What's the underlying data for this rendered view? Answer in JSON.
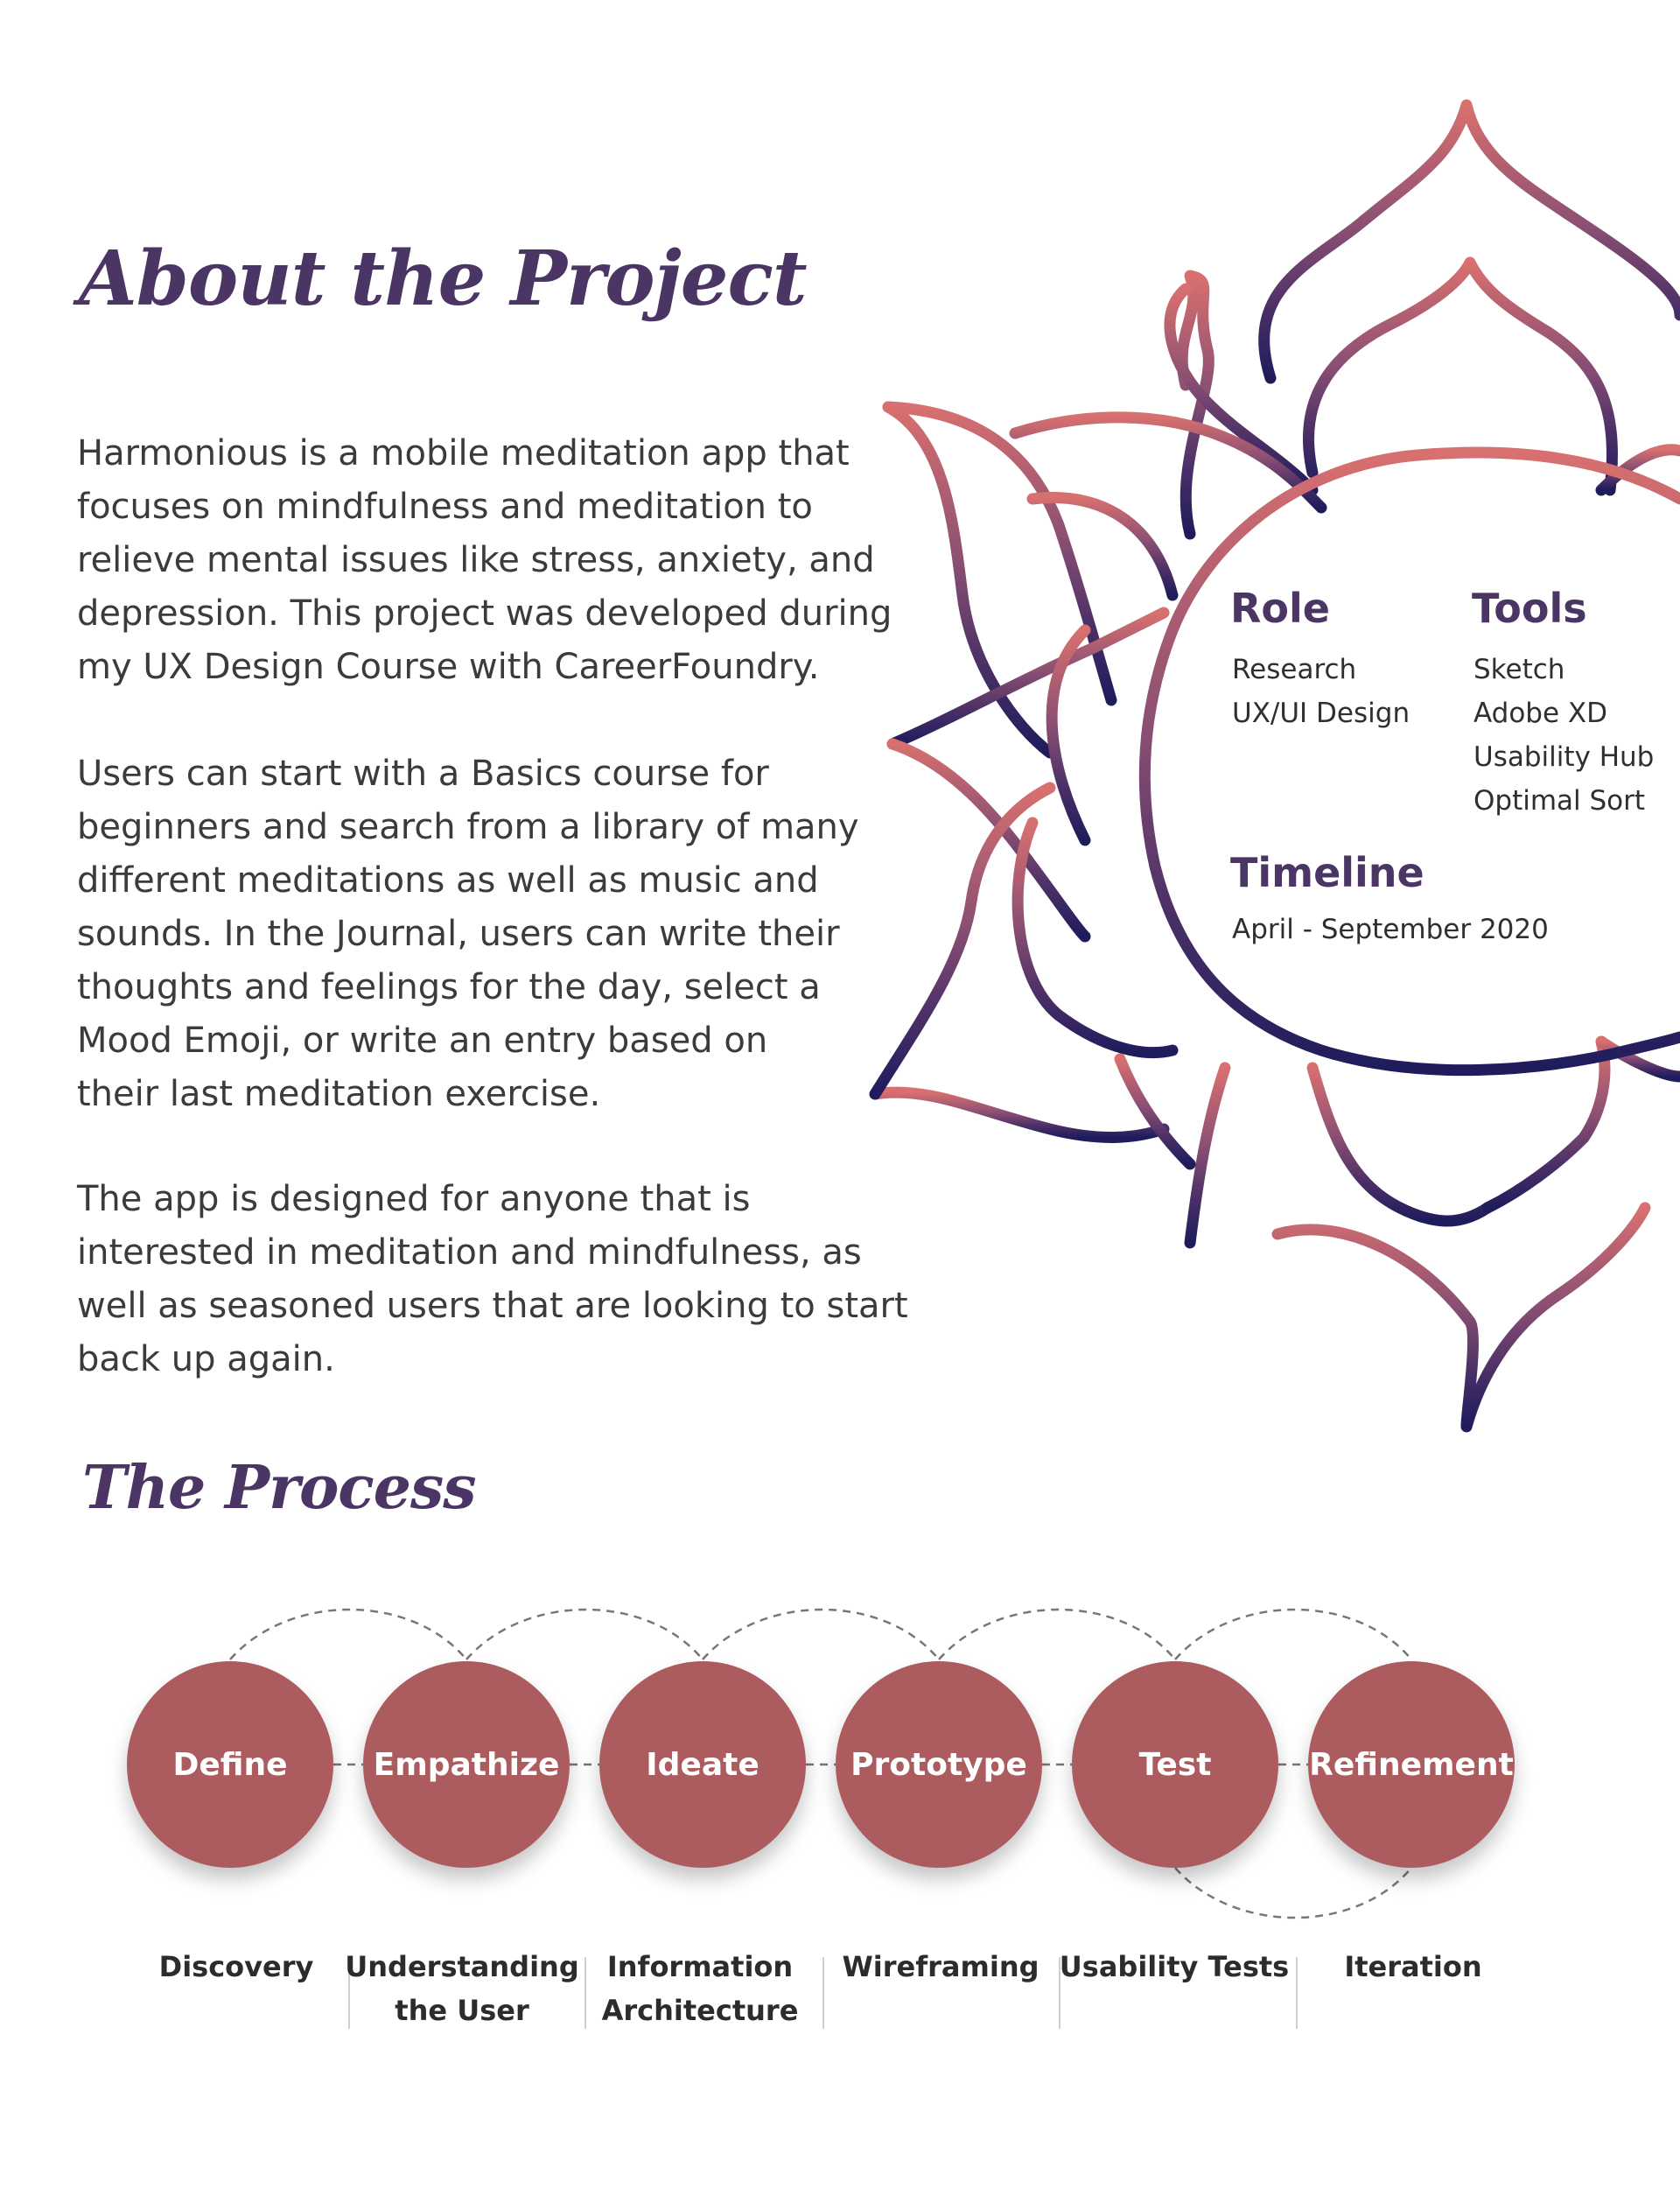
{
  "about": {
    "title": "About the Project",
    "paragraphs": [
      "Harmonious is a mobile meditation app that\nfocuses on mindfulness and meditation to\nrelieve mental issues like stress, anxiety, and\ndepression. This project was developed during\nmy UX Design Course with CareerFoundry.",
      "Users can start with a Basics course for\nbeginners and search from a library of many\ndifferent meditations as well as music and\nsounds. In the Journal, users can write their\nthoughts and feelings for the day, select a\nMood Emoji, or write an entry based on\ntheir last meditation exercise.",
      "The app is designed for anyone that is\ninterested in meditation and mindfulness, as\nwell as seasoned users that are looking to start\nback up again."
    ]
  },
  "info": {
    "role_heading": "Role",
    "role_items": [
      "Research",
      "UX/UI Design"
    ],
    "tools_heading": "Tools",
    "tools_items": [
      "Sketch",
      "Adobe XD",
      "Usability Hub",
      "Optimal Sort"
    ],
    "timeline_heading": "Timeline",
    "timeline_value": "April - September 2020"
  },
  "process": {
    "title": "The Process",
    "steps": [
      "Define",
      "Empathize",
      "Ideate",
      "Prototype",
      "Test",
      "Refinement"
    ],
    "phases": [
      [
        "Discovery"
      ],
      [
        "Understanding",
        "the User"
      ],
      [
        "Information",
        "Architecture"
      ],
      [
        "Wireframing"
      ],
      [
        "Usability Tests"
      ],
      [
        "Iteration"
      ]
    ]
  },
  "colors": {
    "heading": "#4b3564",
    "step_circle": "#ac5c5e",
    "lotus_top": "#d8706f",
    "lotus_bottom": "#1f1c5c"
  }
}
